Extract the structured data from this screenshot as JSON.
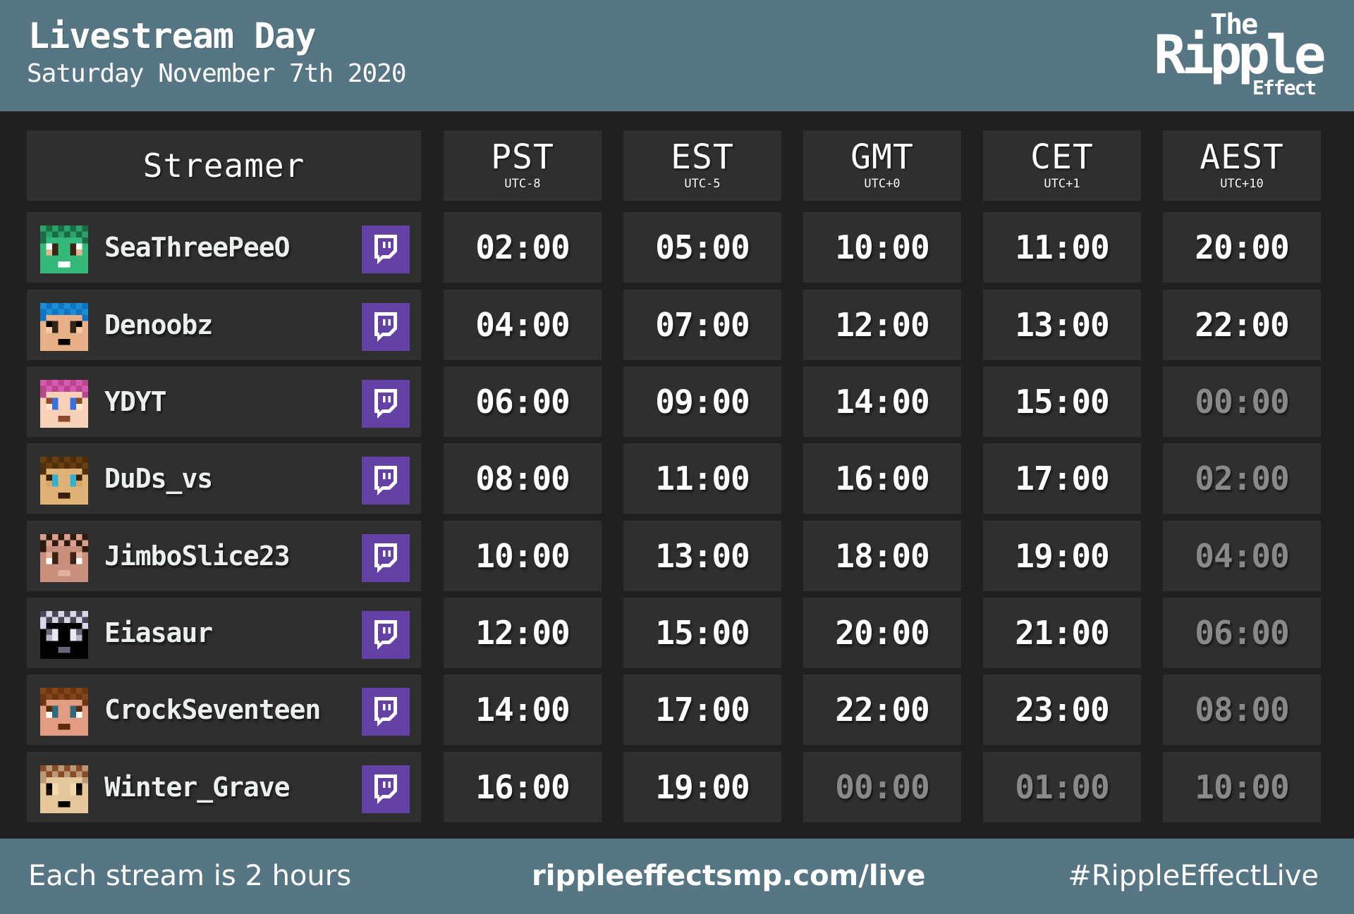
{
  "header": {
    "title": "Livestream Day",
    "subtitle": "Saturday November 7th 2020",
    "logo": {
      "line1": "The",
      "line2": "Ripple",
      "line3": "Effect"
    }
  },
  "colors": {
    "header_bg": "#557682",
    "body_bg": "#202020",
    "cell_bg": "#2f2f2f",
    "twitch": "#6441a5",
    "time_active": "#ffffff",
    "time_next_day": "#898989"
  },
  "table": {
    "streamer_header": "Streamer",
    "timezones": [
      {
        "label": "PST",
        "offset": "UTC-8"
      },
      {
        "label": "EST",
        "offset": "UTC-5"
      },
      {
        "label": "GMT",
        "offset": "UTC+0"
      },
      {
        "label": "CET",
        "offset": "UTC+1"
      },
      {
        "label": "AEST",
        "offset": "UTC+10"
      }
    ],
    "rows": [
      {
        "name": "SeaThreePeeO",
        "avatar": "avatar-green-hair",
        "link_icon": "twitch-icon",
        "times": [
          {
            "value": "02:00",
            "next_day": false
          },
          {
            "value": "05:00",
            "next_day": false
          },
          {
            "value": "10:00",
            "next_day": false
          },
          {
            "value": "11:00",
            "next_day": false
          },
          {
            "value": "20:00",
            "next_day": false
          }
        ]
      },
      {
        "name": "Denoobz",
        "avatar": "avatar-blue-hair",
        "link_icon": "twitch-icon",
        "times": [
          {
            "value": "04:00",
            "next_day": false
          },
          {
            "value": "07:00",
            "next_day": false
          },
          {
            "value": "12:00",
            "next_day": false
          },
          {
            "value": "13:00",
            "next_day": false
          },
          {
            "value": "22:00",
            "next_day": false
          }
        ]
      },
      {
        "name": "YDYT",
        "avatar": "avatar-pink-hair",
        "link_icon": "twitch-icon",
        "times": [
          {
            "value": "06:00",
            "next_day": false
          },
          {
            "value": "09:00",
            "next_day": false
          },
          {
            "value": "14:00",
            "next_day": false
          },
          {
            "value": "15:00",
            "next_day": false
          },
          {
            "value": "00:00",
            "next_day": true
          }
        ]
      },
      {
        "name": "DuDs_vs",
        "avatar": "avatar-brown-hair",
        "link_icon": "twitch-icon",
        "times": [
          {
            "value": "08:00",
            "next_day": false
          },
          {
            "value": "11:00",
            "next_day": false
          },
          {
            "value": "16:00",
            "next_day": false
          },
          {
            "value": "17:00",
            "next_day": false
          },
          {
            "value": "02:00",
            "next_day": true
          }
        ]
      },
      {
        "name": "JimboSlice23",
        "avatar": "avatar-smiling-face",
        "link_icon": "twitch-icon",
        "times": [
          {
            "value": "10:00",
            "next_day": false
          },
          {
            "value": "13:00",
            "next_day": false
          },
          {
            "value": "18:00",
            "next_day": false
          },
          {
            "value": "19:00",
            "next_day": false
          },
          {
            "value": "04:00",
            "next_day": true
          }
        ]
      },
      {
        "name": "Eiasaur",
        "avatar": "avatar-astronaut-helmet",
        "link_icon": "twitch-icon",
        "times": [
          {
            "value": "12:00",
            "next_day": false
          },
          {
            "value": "15:00",
            "next_day": false
          },
          {
            "value": "20:00",
            "next_day": false
          },
          {
            "value": "21:00",
            "next_day": false
          },
          {
            "value": "06:00",
            "next_day": true
          }
        ]
      },
      {
        "name": "CrockSeventeen",
        "avatar": "avatar-bearded-face",
        "link_icon": "twitch-icon",
        "times": [
          {
            "value": "14:00",
            "next_day": false
          },
          {
            "value": "17:00",
            "next_day": false
          },
          {
            "value": "22:00",
            "next_day": false
          },
          {
            "value": "23:00",
            "next_day": false
          },
          {
            "value": "08:00",
            "next_day": true
          }
        ]
      },
      {
        "name": "Winter_Grave",
        "avatar": "avatar-headband-face",
        "link_icon": "twitch-icon",
        "times": [
          {
            "value": "16:00",
            "next_day": false
          },
          {
            "value": "19:00",
            "next_day": false
          },
          {
            "value": "00:00",
            "next_day": true
          },
          {
            "value": "01:00",
            "next_day": true
          },
          {
            "value": "10:00",
            "next_day": true
          }
        ]
      }
    ]
  },
  "footer": {
    "note": "Each stream is 2 hours",
    "url": "rippleeffectsmp.com/live",
    "hashtag": "#RippleEffectLive"
  }
}
